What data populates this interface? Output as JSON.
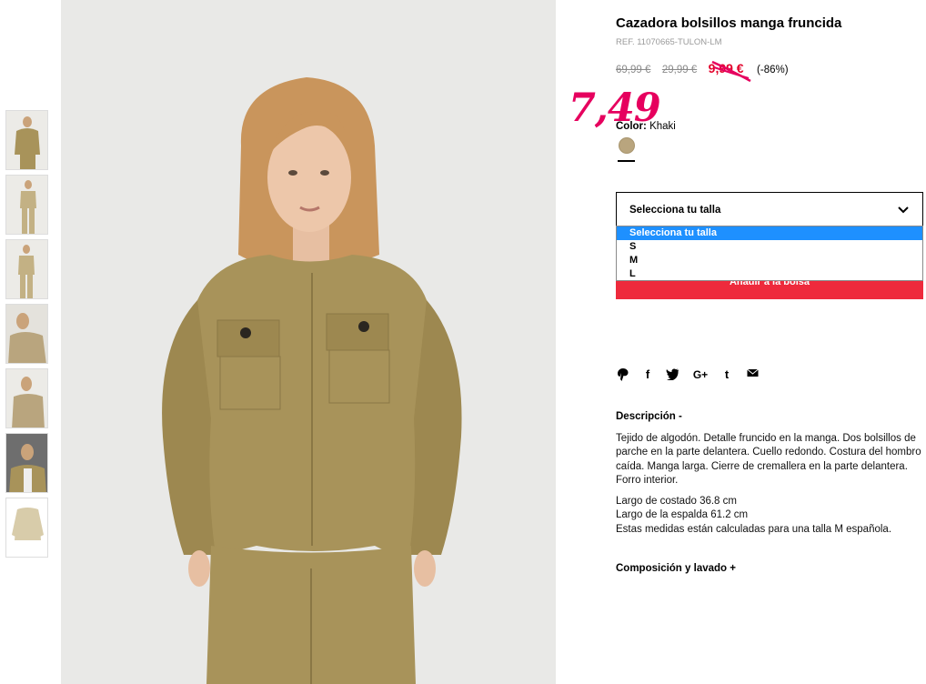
{
  "product": {
    "title": "Cazadora bolsillos manga fruncida",
    "ref": "REF. 11070665-TULON-LM",
    "price_original": "69,99 €",
    "price_previous": "29,99 €",
    "price_sale": "9,99 €",
    "discount": "(-86%)",
    "handwritten_price": "7,49",
    "color_label": "Color:",
    "color_value": "Khaki",
    "color_hex": "#b9a57e"
  },
  "size_select": {
    "label": "Selecciona tu talla",
    "options": [
      "Selecciona tu talla",
      "S",
      "M",
      "L"
    ],
    "selected_index": 0
  },
  "add_to_bag_label": "Añadir a la bolsa",
  "social_icons": [
    "pinterest-icon",
    "facebook-icon",
    "twitter-icon",
    "google-plus-icon",
    "tumblr-icon",
    "email-icon"
  ],
  "social_glyphs": [
    "ⓟ",
    "f",
    "🐦",
    "G+",
    "t",
    "✉"
  ],
  "description": {
    "heading": "Descripción  -",
    "text": "Tejido de algodón. Detalle fruncido en la manga. Dos bolsillos de parche en la parte delantera. Cuello redondo. Costura del hombro caída. Manga larga. Cierre de cremallera en la parte delantera. Forro interior.",
    "measure_1": "Largo de costado 36.8 cm",
    "measure_2": "Largo de la espalda 61.2 cm",
    "measure_3": "Estas medidas están calculadas para una talla M española."
  },
  "composition_heading": "Composición y lavado  +",
  "colors": {
    "sale_red": "#e2002a",
    "handwritten_pink": "#e6005e",
    "button_red": "#ee2a3c",
    "dropdown_highlight": "#1e90ff",
    "jacket_khaki": "#a8935a"
  }
}
